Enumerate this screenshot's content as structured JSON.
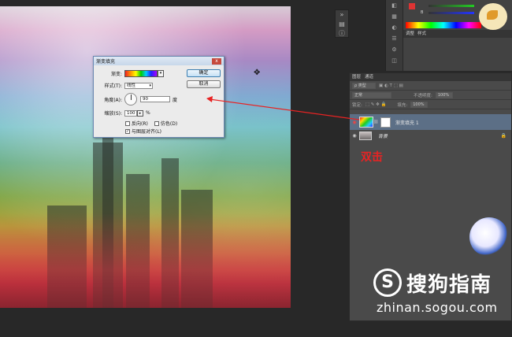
{
  "dialog": {
    "title": "渐变填充",
    "close_label": "x",
    "gradient_label": "渐变:",
    "style_label": "样式(T):",
    "style_value": "线性",
    "angle_label": "角度(A):",
    "angle_value": "90",
    "angle_unit": "度",
    "scale_label": "缩放(S):",
    "scale_value": "100",
    "scale_unit": "%",
    "reverse_label": "反向(R)",
    "dither_label": "仿色(D)",
    "align_label": "与图层对齐(L)",
    "ok_label": "确定",
    "cancel_label": "取消"
  },
  "layers_panel": {
    "tab_layers": "图层",
    "tab_channels": "通道",
    "filter_label": "ρ 类型",
    "blend_mode": "正常",
    "opacity_label": "不透明度:",
    "opacity_value": "100%",
    "lock_label": "锁定:",
    "fill_label": "填充:",
    "fill_value": "100%",
    "layers": [
      {
        "name": "渐变填充 1",
        "selected": true
      },
      {
        "name": "背景",
        "selected": false
      }
    ]
  },
  "right_top": {
    "tab_adjust": "调整",
    "tab_style": "样式",
    "color_b": "B"
  },
  "annotation": {
    "text": "双击",
    "color": "#e82323"
  },
  "watermark": {
    "logo": "S",
    "title": "搜狗指南",
    "url": "zhinan.sogou.com"
  },
  "icons": [
    "eye-icon",
    "chain-icon",
    "lock-icon",
    "close-icon",
    "info-icon",
    "cursor-icon"
  ]
}
